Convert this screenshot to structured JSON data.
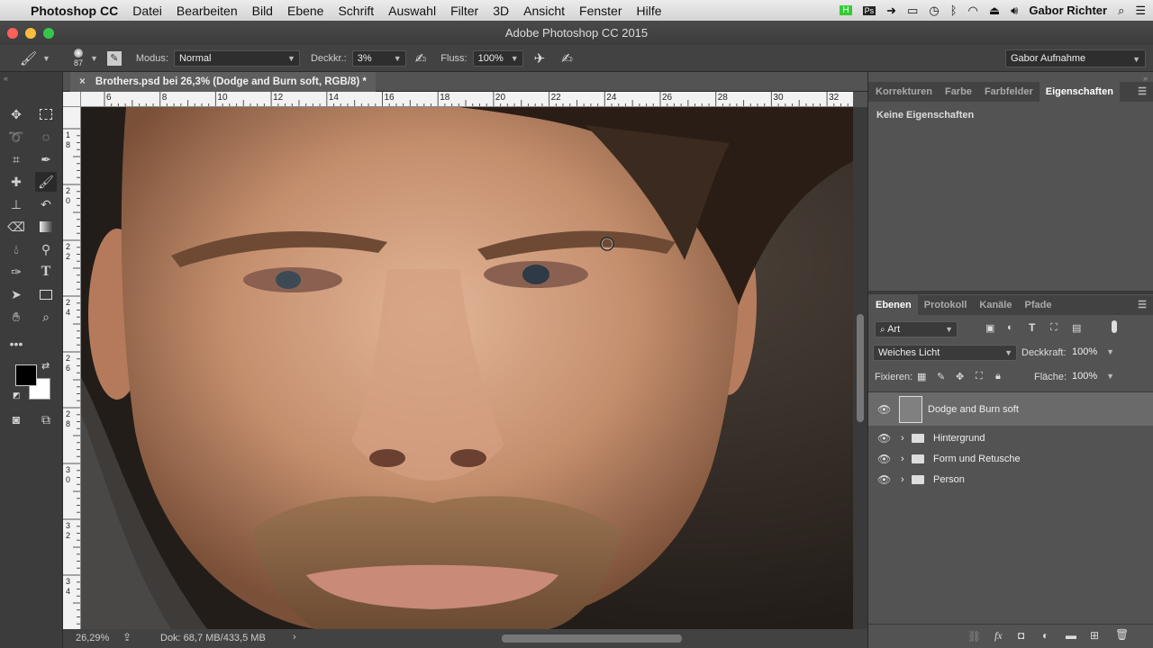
{
  "menubar": {
    "apple": "",
    "app": "Photoshop CC",
    "items": [
      "Datei",
      "Bearbeiten",
      "Bild",
      "Ebene",
      "Schrift",
      "Auswahl",
      "Filter",
      "3D",
      "Ansicht",
      "Fenster",
      "Hilfe"
    ],
    "user": "Gabor Richter"
  },
  "window": {
    "title": "Adobe Photoshop CC 2015"
  },
  "options": {
    "brush_size": "87",
    "mode_label": "Modus:",
    "mode_value": "Normal",
    "opacity_label": "Deckkr.:",
    "opacity_value": "3%",
    "flow_label": "Fluss:",
    "flow_value": "100%",
    "workspace": "Gabor Aufnahme"
  },
  "document": {
    "tab_title": "Brothers.psd bei 26,3% (Dodge and Burn soft, RGB/8) *",
    "ruler_h": [
      "6",
      "8",
      "10",
      "12",
      "14",
      "16",
      "18",
      "20",
      "22",
      "24",
      "26",
      "28",
      "30",
      "32"
    ],
    "ruler_v": [
      "1\n8",
      "2\n0",
      "2\n2",
      "2\n4",
      "2\n6",
      "2\n8",
      "3\n0",
      "3\n2",
      "3\n4"
    ]
  },
  "status": {
    "zoom": "26,29%",
    "doc": "Dok: 68,7 MB/433,5 MB"
  },
  "properties_panel": {
    "tabs": [
      "Korrekturen",
      "Farbe",
      "Farbfelder",
      "Eigenschaften"
    ],
    "active_tab": "Eigenschaften",
    "empty_text": "Keine Eigenschaften"
  },
  "layers_panel": {
    "tabs": [
      "Ebenen",
      "Protokoll",
      "Kanäle",
      "Pfade"
    ],
    "active_tab": "Ebenen",
    "filter_kind": "Art",
    "blend_mode": "Weiches Licht",
    "opacity_label": "Deckkraft:",
    "opacity_value": "100%",
    "lock_label": "Fixieren:",
    "fill_label": "Fläche:",
    "fill_value": "100%",
    "layers": [
      {
        "name": "Dodge and Burn soft",
        "type": "layer",
        "selected": true
      },
      {
        "name": "Hintergrund",
        "type": "group"
      },
      {
        "name": "Form und Retusche",
        "type": "group"
      },
      {
        "name": "Person",
        "type": "group"
      }
    ]
  },
  "colors": {
    "accent": "#5f5f5f",
    "foreground": "#000000",
    "background": "#ffffff"
  }
}
